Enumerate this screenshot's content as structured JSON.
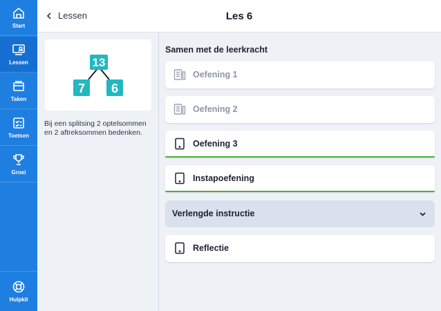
{
  "nav": {
    "items": [
      {
        "label": "Start",
        "icon": "home-icon"
      },
      {
        "label": "Lessen",
        "icon": "lessons-icon"
      },
      {
        "label": "Taken",
        "icon": "tasks-icon"
      },
      {
        "label": "Toetsen",
        "icon": "tests-icon"
      },
      {
        "label": "Groei",
        "icon": "trophy-icon"
      }
    ],
    "bottom": {
      "label": "Hulpkit",
      "icon": "lifebuoy-icon"
    }
  },
  "header": {
    "back_label": "Lessen",
    "title": "Les 6"
  },
  "lesson": {
    "diagram": {
      "top": "13",
      "left": "7",
      "right": "6"
    },
    "description": "Bij een splitsing 2 optelsommen en 2 aftreksommen bedenken."
  },
  "exercises": {
    "section_title": "Samen met de leerkracht",
    "items": [
      {
        "label": "Oefening 1",
        "state": "disabled"
      },
      {
        "label": "Oefening 2",
        "state": "disabled"
      },
      {
        "label": "Oefening 3",
        "state": "done"
      },
      {
        "label": "Instapoefening",
        "state": "done"
      },
      {
        "label": "Verlengde instructie",
        "state": "collapsed"
      },
      {
        "label": "Reflectie",
        "state": "open"
      }
    ]
  },
  "colors": {
    "brand": "#1e7fe0",
    "accent": "#22b8c0",
    "done": "#4caf3f"
  }
}
